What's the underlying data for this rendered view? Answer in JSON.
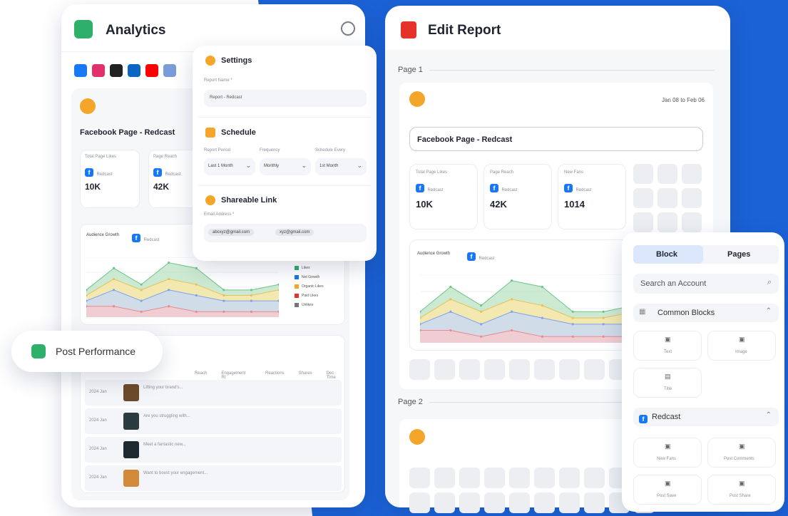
{
  "analytics": {
    "title": "Analytics",
    "social_icons": [
      "facebook-icon",
      "instagram-icon",
      "x-icon",
      "linkedin-icon",
      "youtube-icon",
      "other-icon"
    ],
    "page_title": "Facebook Page - Redcast",
    "stats": [
      {
        "label": "Total Page Likes",
        "badge": "Redcast",
        "value": "10K"
      },
      {
        "label": "Page Reach",
        "badge": "Redcast",
        "value": "42K"
      }
    ],
    "audience_title": "Audience Growth",
    "audience_badge": "Redcast",
    "legend": [
      "Likes",
      "Net Growth",
      "Organic Likes",
      "Paid Likes",
      "Unlikes"
    ],
    "table_headers": [
      "Reach",
      "Engagement Rt",
      "Reactions",
      "Shares",
      "Dec Time"
    ],
    "rows": [
      {
        "date": "2024 Jan",
        "text": "Lifting your brand's..."
      },
      {
        "date": "2024 Jan",
        "text": "Are you struggling with..."
      },
      {
        "date": "2024 Jan",
        "text": "Meet a fantastic new..."
      },
      {
        "date": "2024 Jan",
        "text": "Want to boost your engagement..."
      }
    ]
  },
  "settings": {
    "title": "Settings",
    "report_name_label": "Report Name *",
    "report_name_value": "Report - Redcast",
    "schedule_title": "Schedule",
    "period_label": "Report Period",
    "period_value": "Last 1 Month",
    "frequency_label": "Frequency",
    "frequency_value": "Monthly",
    "every_label": "Schedule Every",
    "every_value": "1st Month",
    "share_title": "Shareable Link",
    "email_label": "Email Address *",
    "emails": [
      "abcxyz@gmail.com",
      "xyz@gmail.com"
    ]
  },
  "post_performance": {
    "label": "Post Performance"
  },
  "edit_report": {
    "title": "Edit Report",
    "page1": "Page 1",
    "page2": "Page 2",
    "date_range": "Jan 08 to Feb 06",
    "page_title": "Facebook Page - Redcast",
    "stats": [
      {
        "label": "Total Page Likes",
        "badge": "Redcast",
        "value": "10K"
      },
      {
        "label": "Page Reach",
        "badge": "Redcast",
        "value": "42K"
      },
      {
        "label": "New Fans",
        "badge": "Redcast",
        "value": "1014"
      }
    ],
    "audience_title": "Audience Growth",
    "audience_badge": "Redcast"
  },
  "block_panel": {
    "tab_block": "Block",
    "tab_pages": "Pages",
    "search_placeholder": "Search an Account",
    "common_title": "Common Blocks",
    "common_items": [
      "Text",
      "Image",
      "Title"
    ],
    "redcast_title": "Redcast",
    "redcast_items": [
      "New Fans",
      "Post Comments",
      "Post Save",
      "Post Share"
    ]
  },
  "chart_data": {
    "type": "area",
    "series": [
      {
        "values": [
          5,
          9,
          6,
          10,
          9,
          5,
          5,
          6
        ]
      },
      {
        "values": [
          4,
          7,
          5,
          7,
          6,
          4,
          4,
          5
        ]
      },
      {
        "values": [
          3,
          5,
          3,
          5,
          4,
          3,
          3,
          3
        ]
      },
      {
        "values": [
          2,
          2,
          1,
          2,
          1,
          1,
          1,
          1
        ]
      }
    ],
    "colors": [
      "#bfe3c5",
      "#fbe7a8",
      "#c8d8f8",
      "#f6c9cc"
    ]
  }
}
